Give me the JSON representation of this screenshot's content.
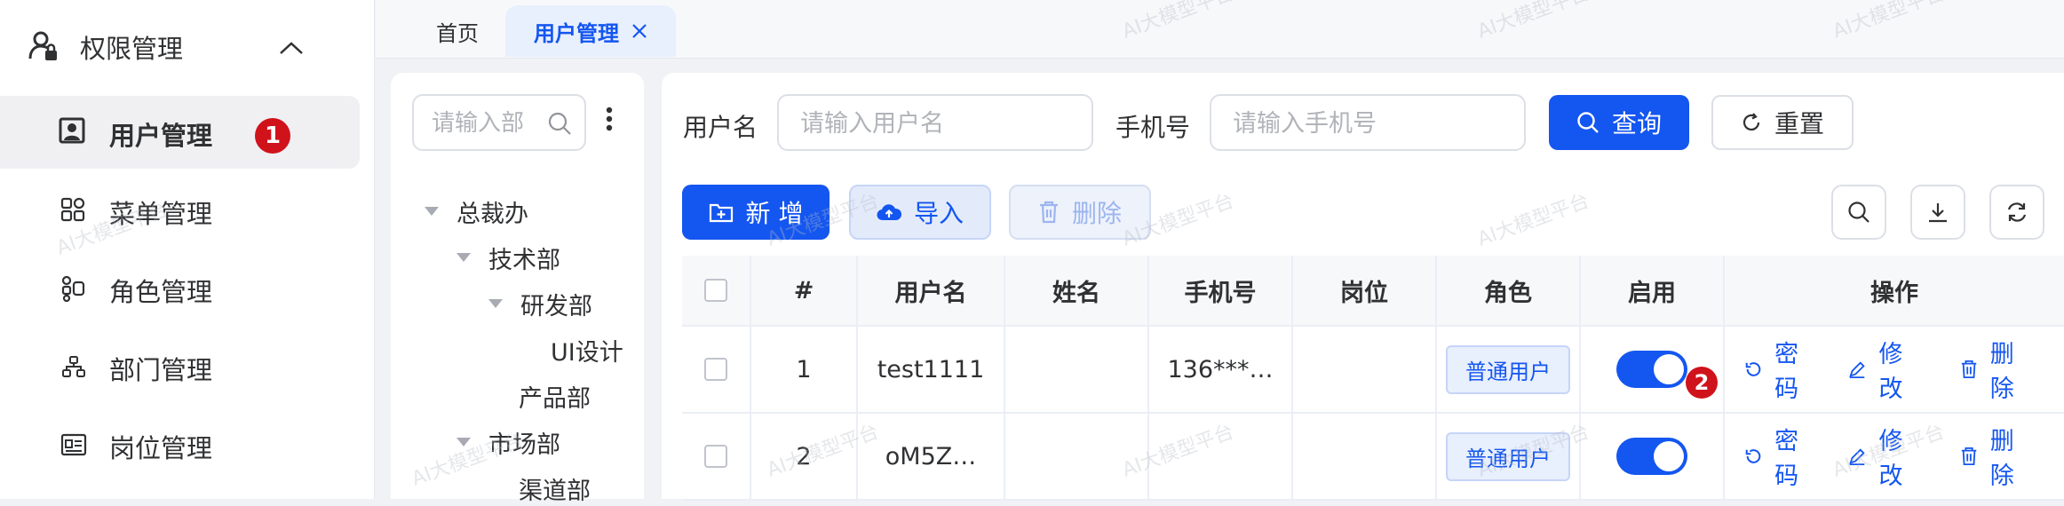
{
  "sidebar": {
    "group_label": "权限管理",
    "items": [
      {
        "label": "用户管理",
        "badge": "1"
      },
      {
        "label": "菜单管理"
      },
      {
        "label": "角色管理"
      },
      {
        "label": "部门管理"
      },
      {
        "label": "岗位管理"
      }
    ]
  },
  "tabs": [
    {
      "label": "首页"
    },
    {
      "label": "用户管理"
    }
  ],
  "tree": {
    "search_placeholder": "请输入部",
    "nodes": [
      "总裁办",
      "技术部",
      "研发部",
      "UI设计",
      "产品部",
      "市场部",
      "渠道部"
    ]
  },
  "search_form": {
    "username_label": "用户名",
    "username_placeholder": "请输入用户名",
    "phone_label": "手机号",
    "phone_placeholder": "请输入手机号",
    "query_label": "查询",
    "reset_label": "重置"
  },
  "toolbar": {
    "add_label": "新 增",
    "import_label": "导入",
    "delete_label": "删除"
  },
  "table": {
    "headers": [
      "#",
      "用户名",
      "姓名",
      "手机号",
      "岗位",
      "角色",
      "启用",
      "操作"
    ],
    "rows": [
      {
        "index": "1",
        "username": "test1111",
        "name": "",
        "phone": "136***…",
        "post": "",
        "role": "普通用户",
        "enabled": true
      },
      {
        "index": "2",
        "username": "oM5Z…",
        "name": "",
        "phone": "",
        "post": "",
        "role": "普通用户",
        "enabled": true
      }
    ],
    "actions": {
      "password": "密码",
      "edit": "修 改",
      "delete": "删除"
    },
    "row_badge": "2"
  },
  "watermark": "AI大模型平台",
  "colors": {
    "primary": "#1456f0",
    "badge": "#d0121b"
  }
}
